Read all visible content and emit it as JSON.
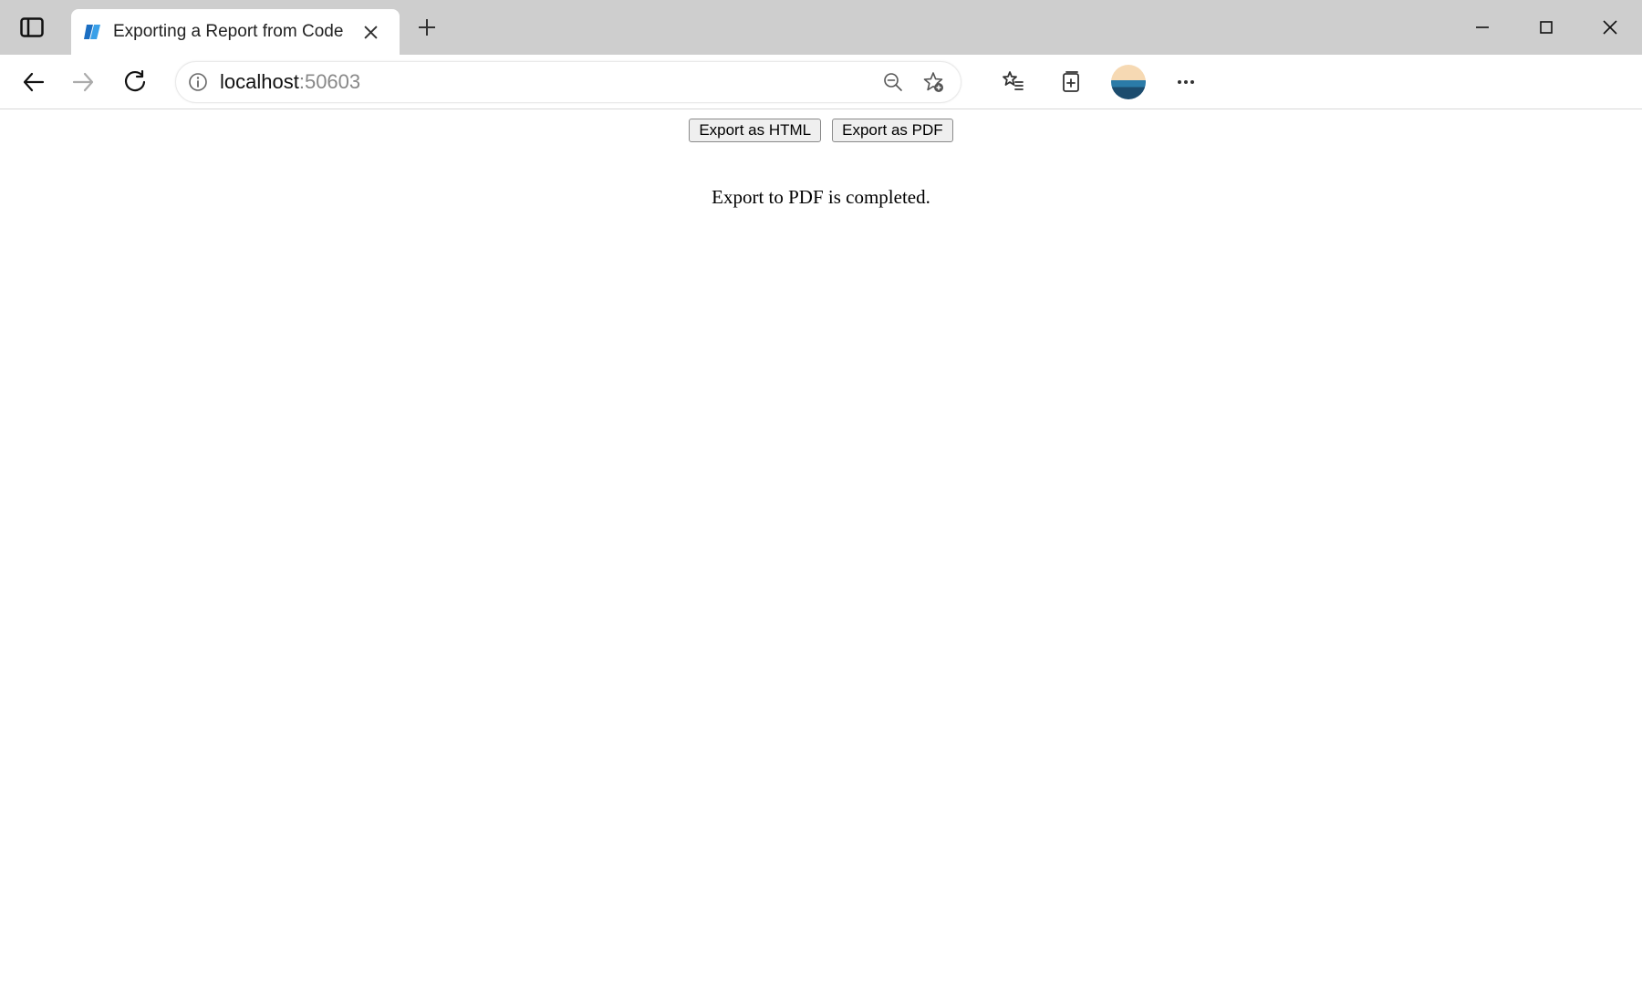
{
  "window": {
    "tab_title": "Exporting a Report from Code"
  },
  "address_bar": {
    "host": "localhost",
    "port": ":50603"
  },
  "page": {
    "buttons": {
      "export_html": "Export as HTML",
      "export_pdf": "Export as PDF"
    },
    "status_message": "Export to PDF is completed."
  }
}
